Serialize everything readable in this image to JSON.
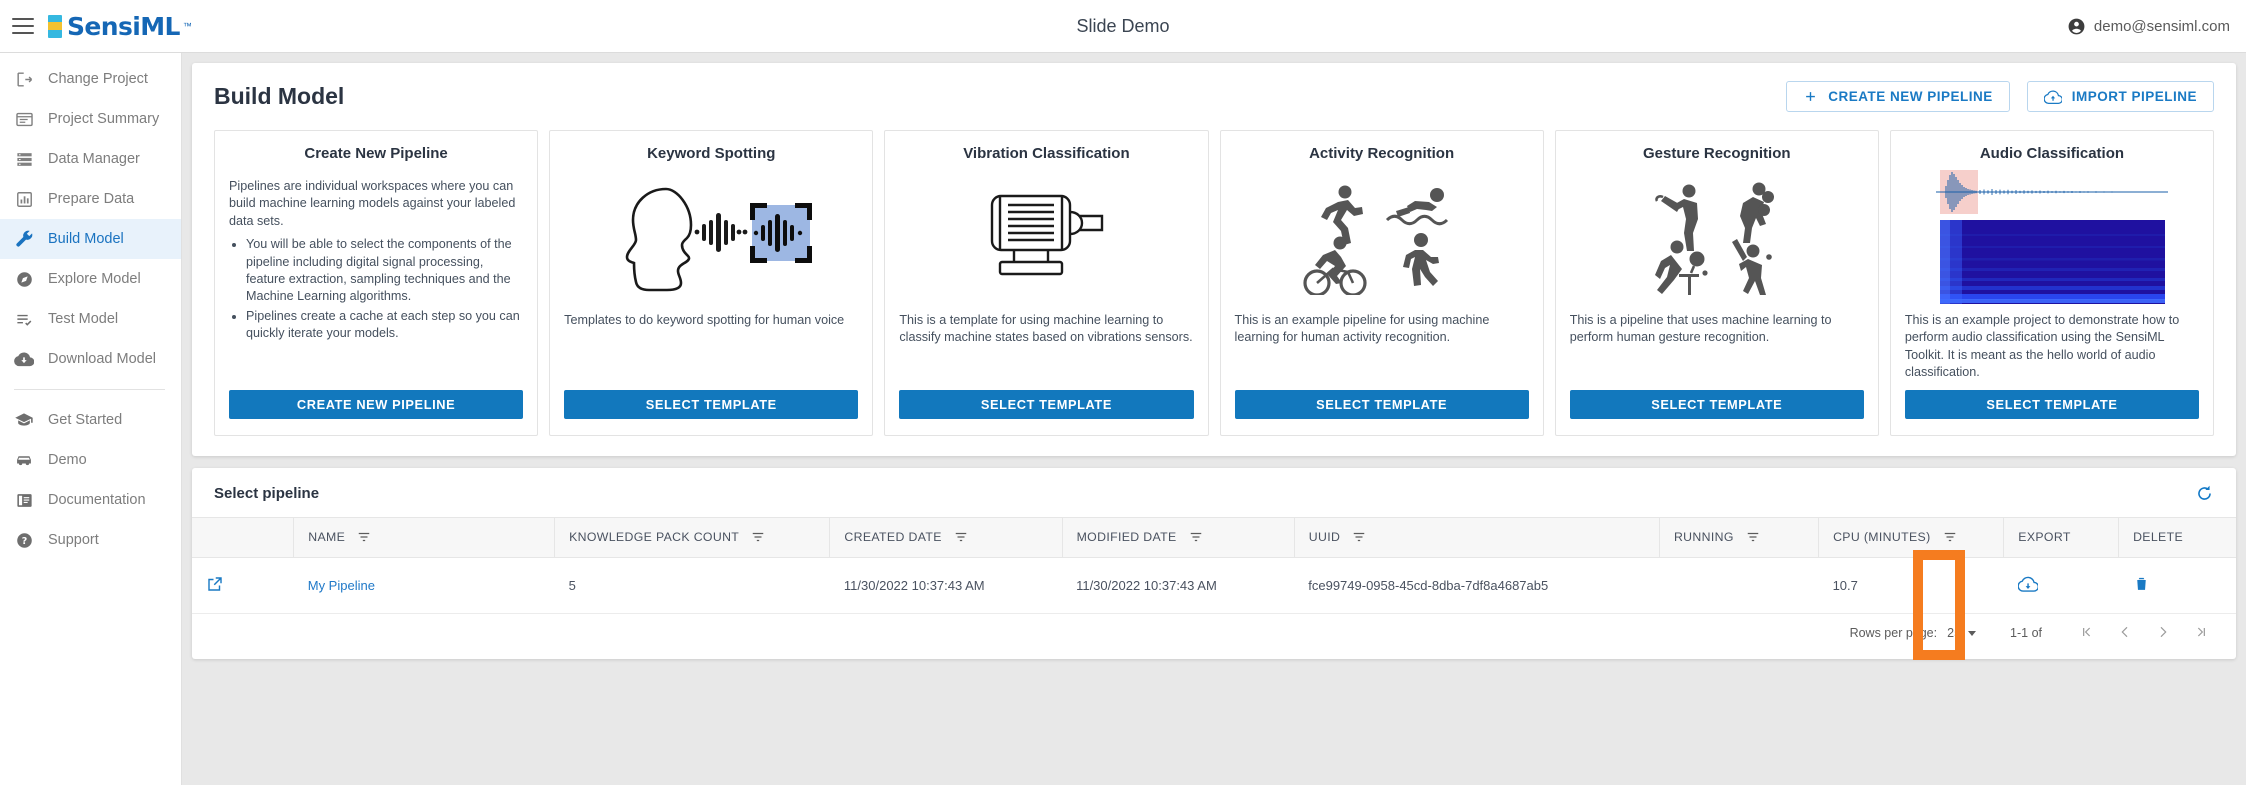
{
  "topbar": {
    "menu_icon": "hamburger-icon",
    "logo_text": "SensiML",
    "logo_tm": "™",
    "logo_colors": [
      "#35b8e0",
      "#f2c230",
      "#35b8e0"
    ],
    "title": "Slide Demo",
    "user_email": "demo@sensiml.com",
    "user_icon": "account-circle-icon"
  },
  "sidebar": {
    "items": [
      {
        "label": "Change Project",
        "icon": "exit-to-app-icon",
        "active": false
      },
      {
        "label": "Project Summary",
        "icon": "web-asset-icon",
        "active": false
      },
      {
        "label": "Data Manager",
        "icon": "storage-icon",
        "active": false
      },
      {
        "label": "Prepare Data",
        "icon": "bar-chart-icon",
        "active": false
      },
      {
        "label": "Build Model",
        "icon": "wrench-icon",
        "active": true
      },
      {
        "label": "Explore Model",
        "icon": "explore-compass-icon",
        "active": false
      },
      {
        "label": "Test Model",
        "icon": "playlist-check-icon",
        "active": false
      },
      {
        "label": "Download Model",
        "icon": "cloud-download-icon",
        "active": false
      }
    ],
    "items2": [
      {
        "label": "Get Started",
        "icon": "graduation-cap-icon",
        "active": false
      },
      {
        "label": "Demo",
        "icon": "car-icon",
        "active": false
      },
      {
        "label": "Documentation",
        "icon": "book-icon",
        "active": false
      },
      {
        "label": "Support",
        "icon": "help-circle-icon",
        "active": false
      }
    ]
  },
  "page": {
    "title": "Build Model",
    "create_pipeline_btn": "CREATE NEW PIPELINE",
    "create_pipeline_icon": "plus-icon",
    "import_pipeline_btn": "IMPORT PIPELINE",
    "import_pipeline_icon": "cloud-upload-icon"
  },
  "cards": [
    {
      "title": "Create New Pipeline",
      "art": "none",
      "intro": "Pipelines are individual workspaces where you can build machine learning models against your labeled data sets.",
      "bullets": [
        "You will be able to select the components of the pipeline including digital signal processing, feature extraction, sampling techniques and the Machine Learning algorithms.",
        "Pipelines create a cache at each step so you can quickly iterate your models."
      ],
      "button": "CREATE NEW PIPELINE"
    },
    {
      "title": "Keyword Spotting",
      "art": "head-speech-waveform",
      "desc": "Templates to do keyword spotting for human voice",
      "button": "SELECT TEMPLATE"
    },
    {
      "title": "Vibration Classification",
      "art": "electric-motor",
      "desc": "This is a template for using machine learning to classify machine states based on vibrations sensors.",
      "button": "SELECT TEMPLATE"
    },
    {
      "title": "Activity Recognition",
      "art": "activity-pictograms",
      "desc": "This is an example pipeline for using machine learning for human activity recognition.",
      "button": "SELECT TEMPLATE"
    },
    {
      "title": "Gesture Recognition",
      "art": "gesture-pictograms",
      "desc": "This is a pipeline that uses machine learning to perform human gesture recognition.",
      "button": "SELECT TEMPLATE"
    },
    {
      "title": "Audio Classification",
      "art": "waveform-spectrogram",
      "desc": "This is an example project to demonstrate how to perform audio classification using the SensiML Toolkit. It is meant as the hello world of audio classification.",
      "button": "SELECT TEMPLATE"
    }
  ],
  "table": {
    "caption": "Select pipeline",
    "refresh_icon": "refresh-icon",
    "columns": [
      {
        "label": "",
        "filter": false
      },
      {
        "label": "NAME",
        "filter": true
      },
      {
        "label": "KNOWLEDGE PACK COUNT",
        "filter": true
      },
      {
        "label": "CREATED DATE",
        "filter": true
      },
      {
        "label": "MODIFIED DATE",
        "filter": true
      },
      {
        "label": "UUID",
        "filter": true
      },
      {
        "label": "RUNNING",
        "filter": true
      },
      {
        "label": "CPU (MINUTES)",
        "filter": true
      },
      {
        "label": "EXPORT",
        "filter": false
      },
      {
        "label": "DELETE",
        "filter": false
      }
    ],
    "rows": [
      {
        "open_icon": "open-in-new-icon",
        "name": "My Pipeline",
        "knowledge_pack_count": "5",
        "created_date": "11/30/2022 10:37:43 AM",
        "modified_date": "11/30/2022 10:37:43 AM",
        "uuid": "fce99749-0958-45cd-8dba-7df8a4687ab5",
        "running": "",
        "cpu_minutes": "10.7",
        "export_icon": "cloud-download-icon",
        "delete_icon": "trash-icon"
      }
    ],
    "pager": {
      "rows_per_page_label": "Rows per page:",
      "rows_per_page_value": "25",
      "range": "1-1 of",
      "first_icon": "first-page-icon",
      "prev_icon": "chevron-left-icon",
      "next_icon": "chevron-right-icon",
      "last_icon": "last-page-icon"
    }
  },
  "annotation": {
    "highlight_color": "#f57c1f",
    "target": "export-column"
  }
}
